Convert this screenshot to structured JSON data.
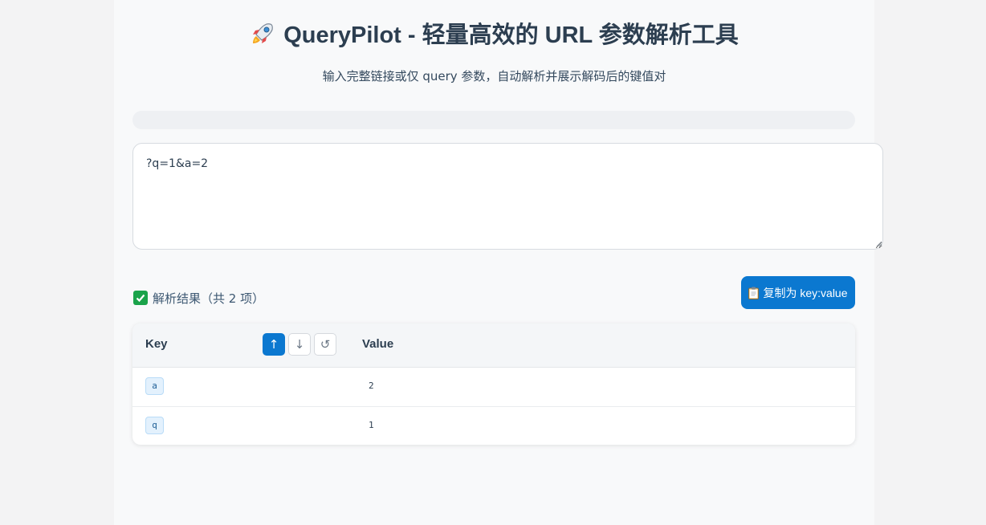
{
  "header": {
    "title": "QueryPilot - 轻量高效的 URL 参数解析工具",
    "subtitle": "输入完整链接或仅 query 参数，自动解析并展示解码后的键值对"
  },
  "input": {
    "value": "?q=1&a=2"
  },
  "result": {
    "title": "解析结果（共 2 项）",
    "copy_label": "复制为 key:value"
  },
  "table": {
    "key_header": "Key",
    "value_header": "Value",
    "sort": {
      "asc": "↑",
      "desc": "↓",
      "reset": "↺"
    },
    "rows": [
      {
        "key": "a",
        "value": "2"
      },
      {
        "key": "q",
        "value": "1"
      }
    ]
  },
  "colors": {
    "accent": "#0b78d0",
    "chip_bg": "#e3f1fd",
    "success": "#1aa34a"
  },
  "icons": {
    "title": "rocket-icon",
    "result": "check-icon",
    "copy": "clipboard-icon"
  }
}
